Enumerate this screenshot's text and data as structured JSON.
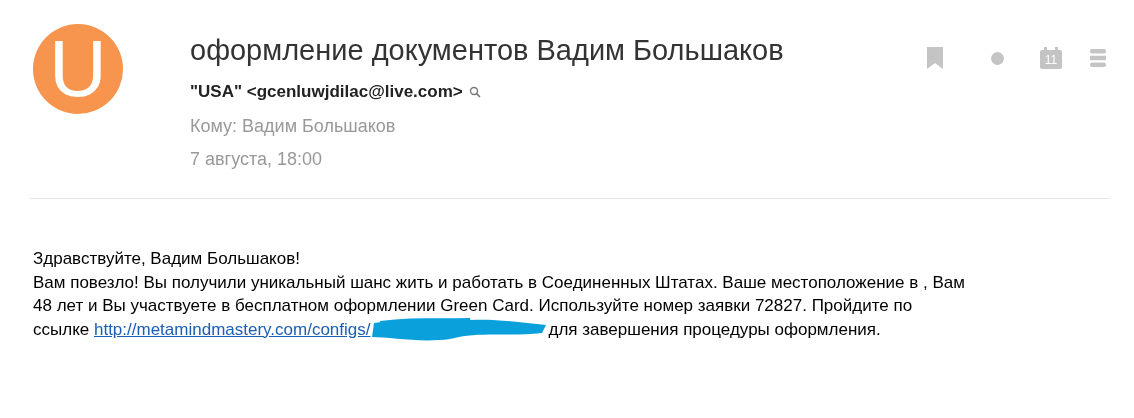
{
  "avatar": {
    "letter": "U"
  },
  "subject": "оформление документов Вадим Большаков",
  "sender": {
    "name": "\"USA\"",
    "address": "<gcenluwjdilac@live.com>"
  },
  "recipient": "Кому: Вадим Большаков",
  "date": "7 августа, 18:00",
  "toolbar": {
    "calendar_day": "11"
  },
  "greeting": "Здравствуйте, Вадим Большаков!",
  "body": {
    "lines": [
      "Вам повезло! Вы получили уникальный шанс жить и работать в Соединенных Штатах. Ваше местоположение в , Вам",
      "48 лет и Вы участвуете в бесплатном оформлении Green Card. Используйте номер заявки 72827. Пройдите по"
    ],
    "link_prefix": "ссылке",
    "link": "http://metamindmastery.com/configs/",
    "link_suffix": "для завершения процедуры оформления."
  }
}
